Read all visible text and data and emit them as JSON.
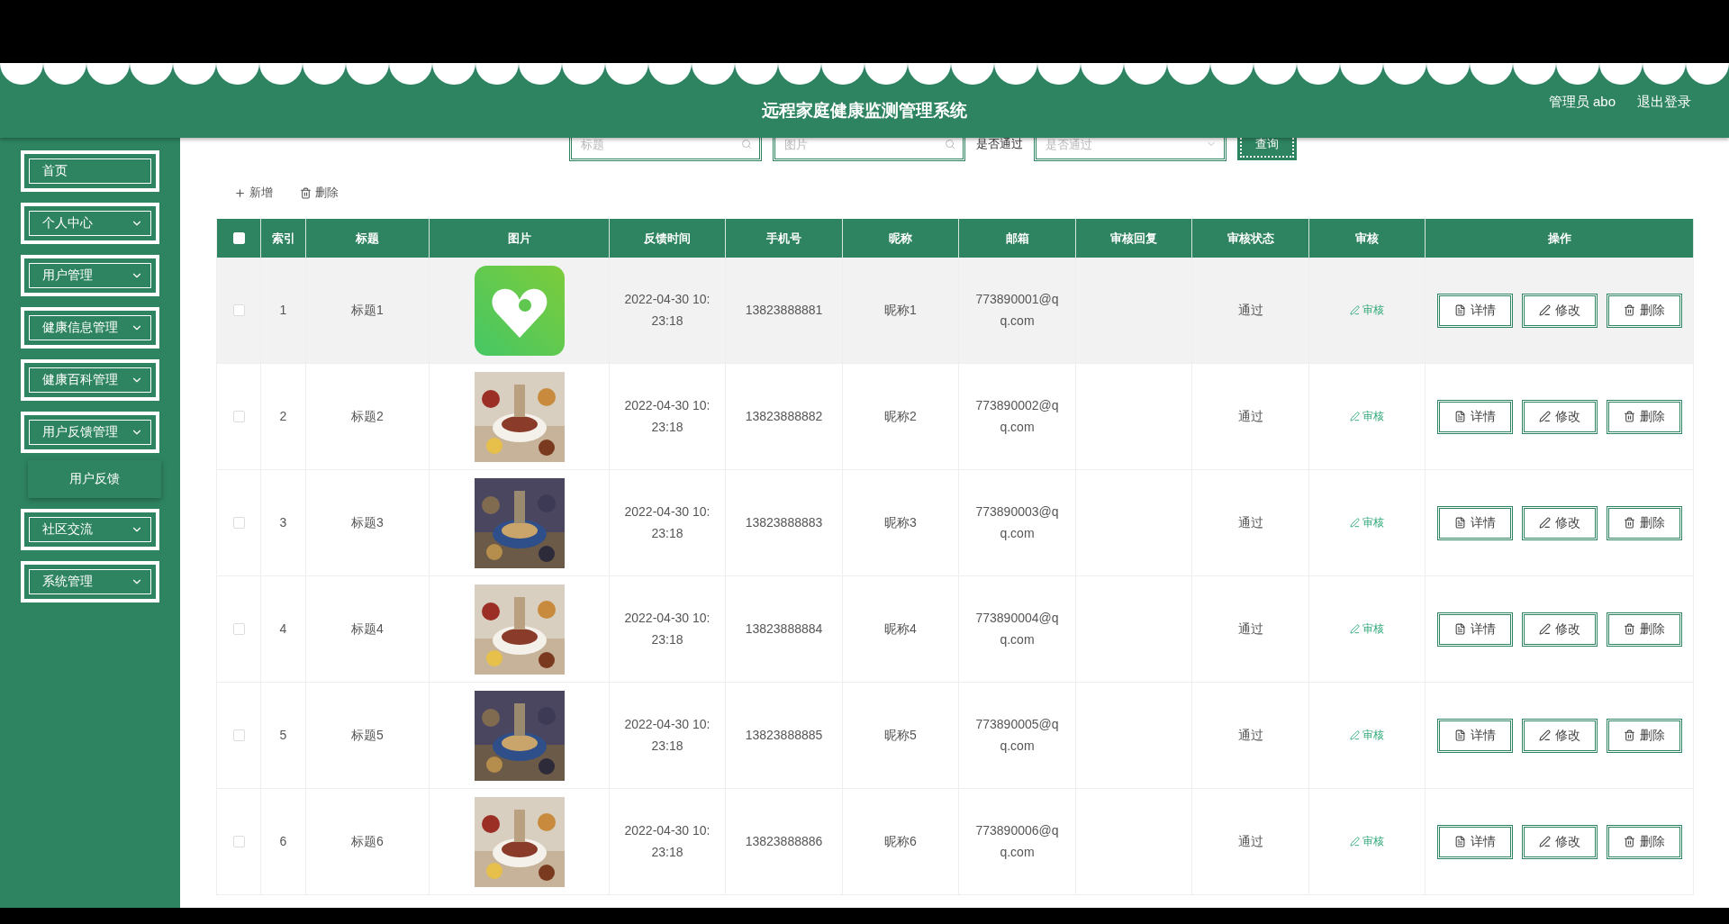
{
  "header": {
    "title": "远程家庭健康监测管理系统",
    "user": "管理员 abo",
    "logout": "退出登录"
  },
  "sidebar": {
    "items": [
      {
        "label": "首页",
        "has_submenu": false
      },
      {
        "label": "个人中心",
        "has_submenu": true
      },
      {
        "label": "用户管理",
        "has_submenu": true
      },
      {
        "label": "健康信息管理",
        "has_submenu": true
      },
      {
        "label": "健康百科管理",
        "has_submenu": true
      },
      {
        "label": "用户反馈管理",
        "has_submenu": true,
        "children": [
          {
            "label": "用户反馈"
          }
        ]
      },
      {
        "label": "社区交流",
        "has_submenu": true
      },
      {
        "label": "系统管理",
        "has_submenu": true
      }
    ]
  },
  "search": {
    "fields": [
      {
        "placeholder": "标题"
      },
      {
        "placeholder": "图片"
      }
    ],
    "filter_label": "是否通过",
    "select_placeholder": "是否通过",
    "button": "查询"
  },
  "toolbar": {
    "add": "新增",
    "delete": "删除"
  },
  "table": {
    "select_all_checked": false,
    "columns": [
      "索引",
      "标题",
      "图片",
      "反馈时间",
      "手机号",
      "昵称",
      "邮箱",
      "审核回复",
      "审核状态",
      "审核",
      "操作"
    ],
    "rows": [
      {
        "index": "1",
        "title": "标题1",
        "kind": "picture",
        "time": "2022-04-30 10:23:18",
        "phone": "13823888881",
        "nickname": "昵称1",
        "email": "773890001@qq.com",
        "status": "通过",
        "review": "审核",
        "actions": [
          "详情",
          "修改",
          "删除"
        ],
        "hovered": true,
        "checked": false
      },
      {
        "index": "2",
        "title": "标题2",
        "kind": "picture",
        "time": "2022-04-30 10:23:18",
        "phone": "13823888882",
        "nickname": "昵称2",
        "email": "773890002@qq.com",
        "status": "通过",
        "review": "审核",
        "actions": [
          "详情",
          "修改",
          "删除"
        ],
        "hovered": false,
        "checked": false
      },
      {
        "index": "3",
        "title": "标题3",
        "kind": "picture",
        "time": "2022-04-30 10:23:18",
        "phone": "13823888883",
        "nickname": "昵称3",
        "email": "773890003@qq.com",
        "status": "通过",
        "review": "审核",
        "actions": [
          "详情",
          "修改",
          "删除"
        ],
        "hovered": false,
        "checked": false
      },
      {
        "index": "4",
        "title": "标题4",
        "kind": "picture",
        "time": "2022-04-30 10:23:18",
        "phone": "13823888884",
        "nickname": "昵称4",
        "email": "773890004@qq.com",
        "status": "通过",
        "review": "审核",
        "actions": [
          "详情",
          "修改",
          "删除"
        ],
        "hovered": false,
        "checked": false
      },
      {
        "index": "5",
        "title": "标题5",
        "kind": "picture",
        "time": "2022-04-30 10:23:18",
        "phone": "13823888885",
        "nickname": "昵称5",
        "email": "773890005@qq.com",
        "status": "通过",
        "review": "审核",
        "actions": [
          "详情",
          "修改",
          "删除"
        ],
        "hovered": false,
        "checked": false
      },
      {
        "index": "6",
        "title": "标题6",
        "kind": "picture",
        "time": "2022-04-30 10:23:18",
        "phone": "13823888886",
        "nickname": "昵称6",
        "email": "773890006@qq.com",
        "status": "通过",
        "review": "审核",
        "actions": [
          "详情",
          "修改",
          "删除"
        ],
        "hovered": false,
        "checked": false
      }
    ]
  }
}
